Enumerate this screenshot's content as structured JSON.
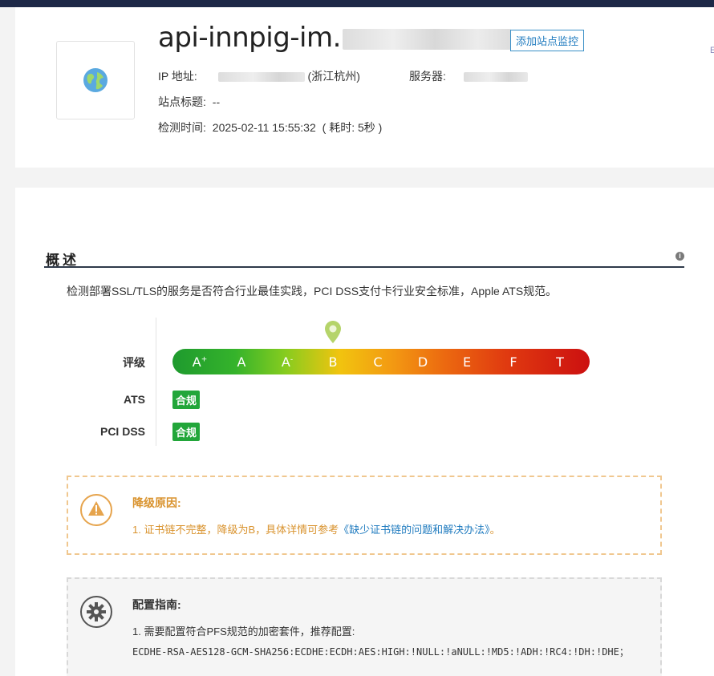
{
  "header": {
    "title_visible": "api-innpig-im.",
    "add_monitor_label": "添加站点监控",
    "edge_mark": "E",
    "ip_label": "IP 地址:",
    "ip_location": "(浙江杭州)",
    "server_label": "服务器:",
    "site_title_label": "站点标题:",
    "site_title_value": "--",
    "check_time_label": "检测时间:",
    "check_time_value": "2025-02-11 15:55:32",
    "duration_text": "( 耗时: 5秒 )"
  },
  "overview": {
    "title": "概述",
    "help_icon_text": "i",
    "description": "检测部署SSL/TLS的服务是否符合行业最佳实践，PCI DSS支付卡行业安全标准，Apple ATS规范。",
    "grade_label": "评级",
    "grades": [
      "A+",
      "A",
      "A-",
      "B",
      "C",
      "D",
      "E",
      "F",
      "T"
    ],
    "current_grade": "B",
    "ats_label": "ATS",
    "ats_status": "合规",
    "pci_label": "PCI DSS",
    "pci_status": "合规"
  },
  "downgrade": {
    "title": "降级原因:",
    "item_prefix": "1. 证书链不完整，降级为B，具体详情可参考",
    "item_link": "《缺少证书链的问题和解决办法》",
    "item_suffix": "。"
  },
  "guide": {
    "title": "配置指南:",
    "item": "1. 需要配置符合PFS规范的加密套件，推荐配置:",
    "cipher": "ECDHE-RSA-AES128-GCM-SHA256:ECDHE:ECDH:AES:HIGH:!NULL:!aNULL:!MD5:!ADH:!RC4:!DH:!DHE；"
  },
  "colors": {
    "accent_blue": "#1f7bbf",
    "warning_orange": "#d9932e",
    "pass_green": "#22a63a",
    "topbar": "#1d2847"
  },
  "icons": {
    "logo": "globe-icon",
    "warning": "warning-triangle-icon",
    "guide": "gear-icon",
    "grade_marker": "map-pin-icon"
  }
}
